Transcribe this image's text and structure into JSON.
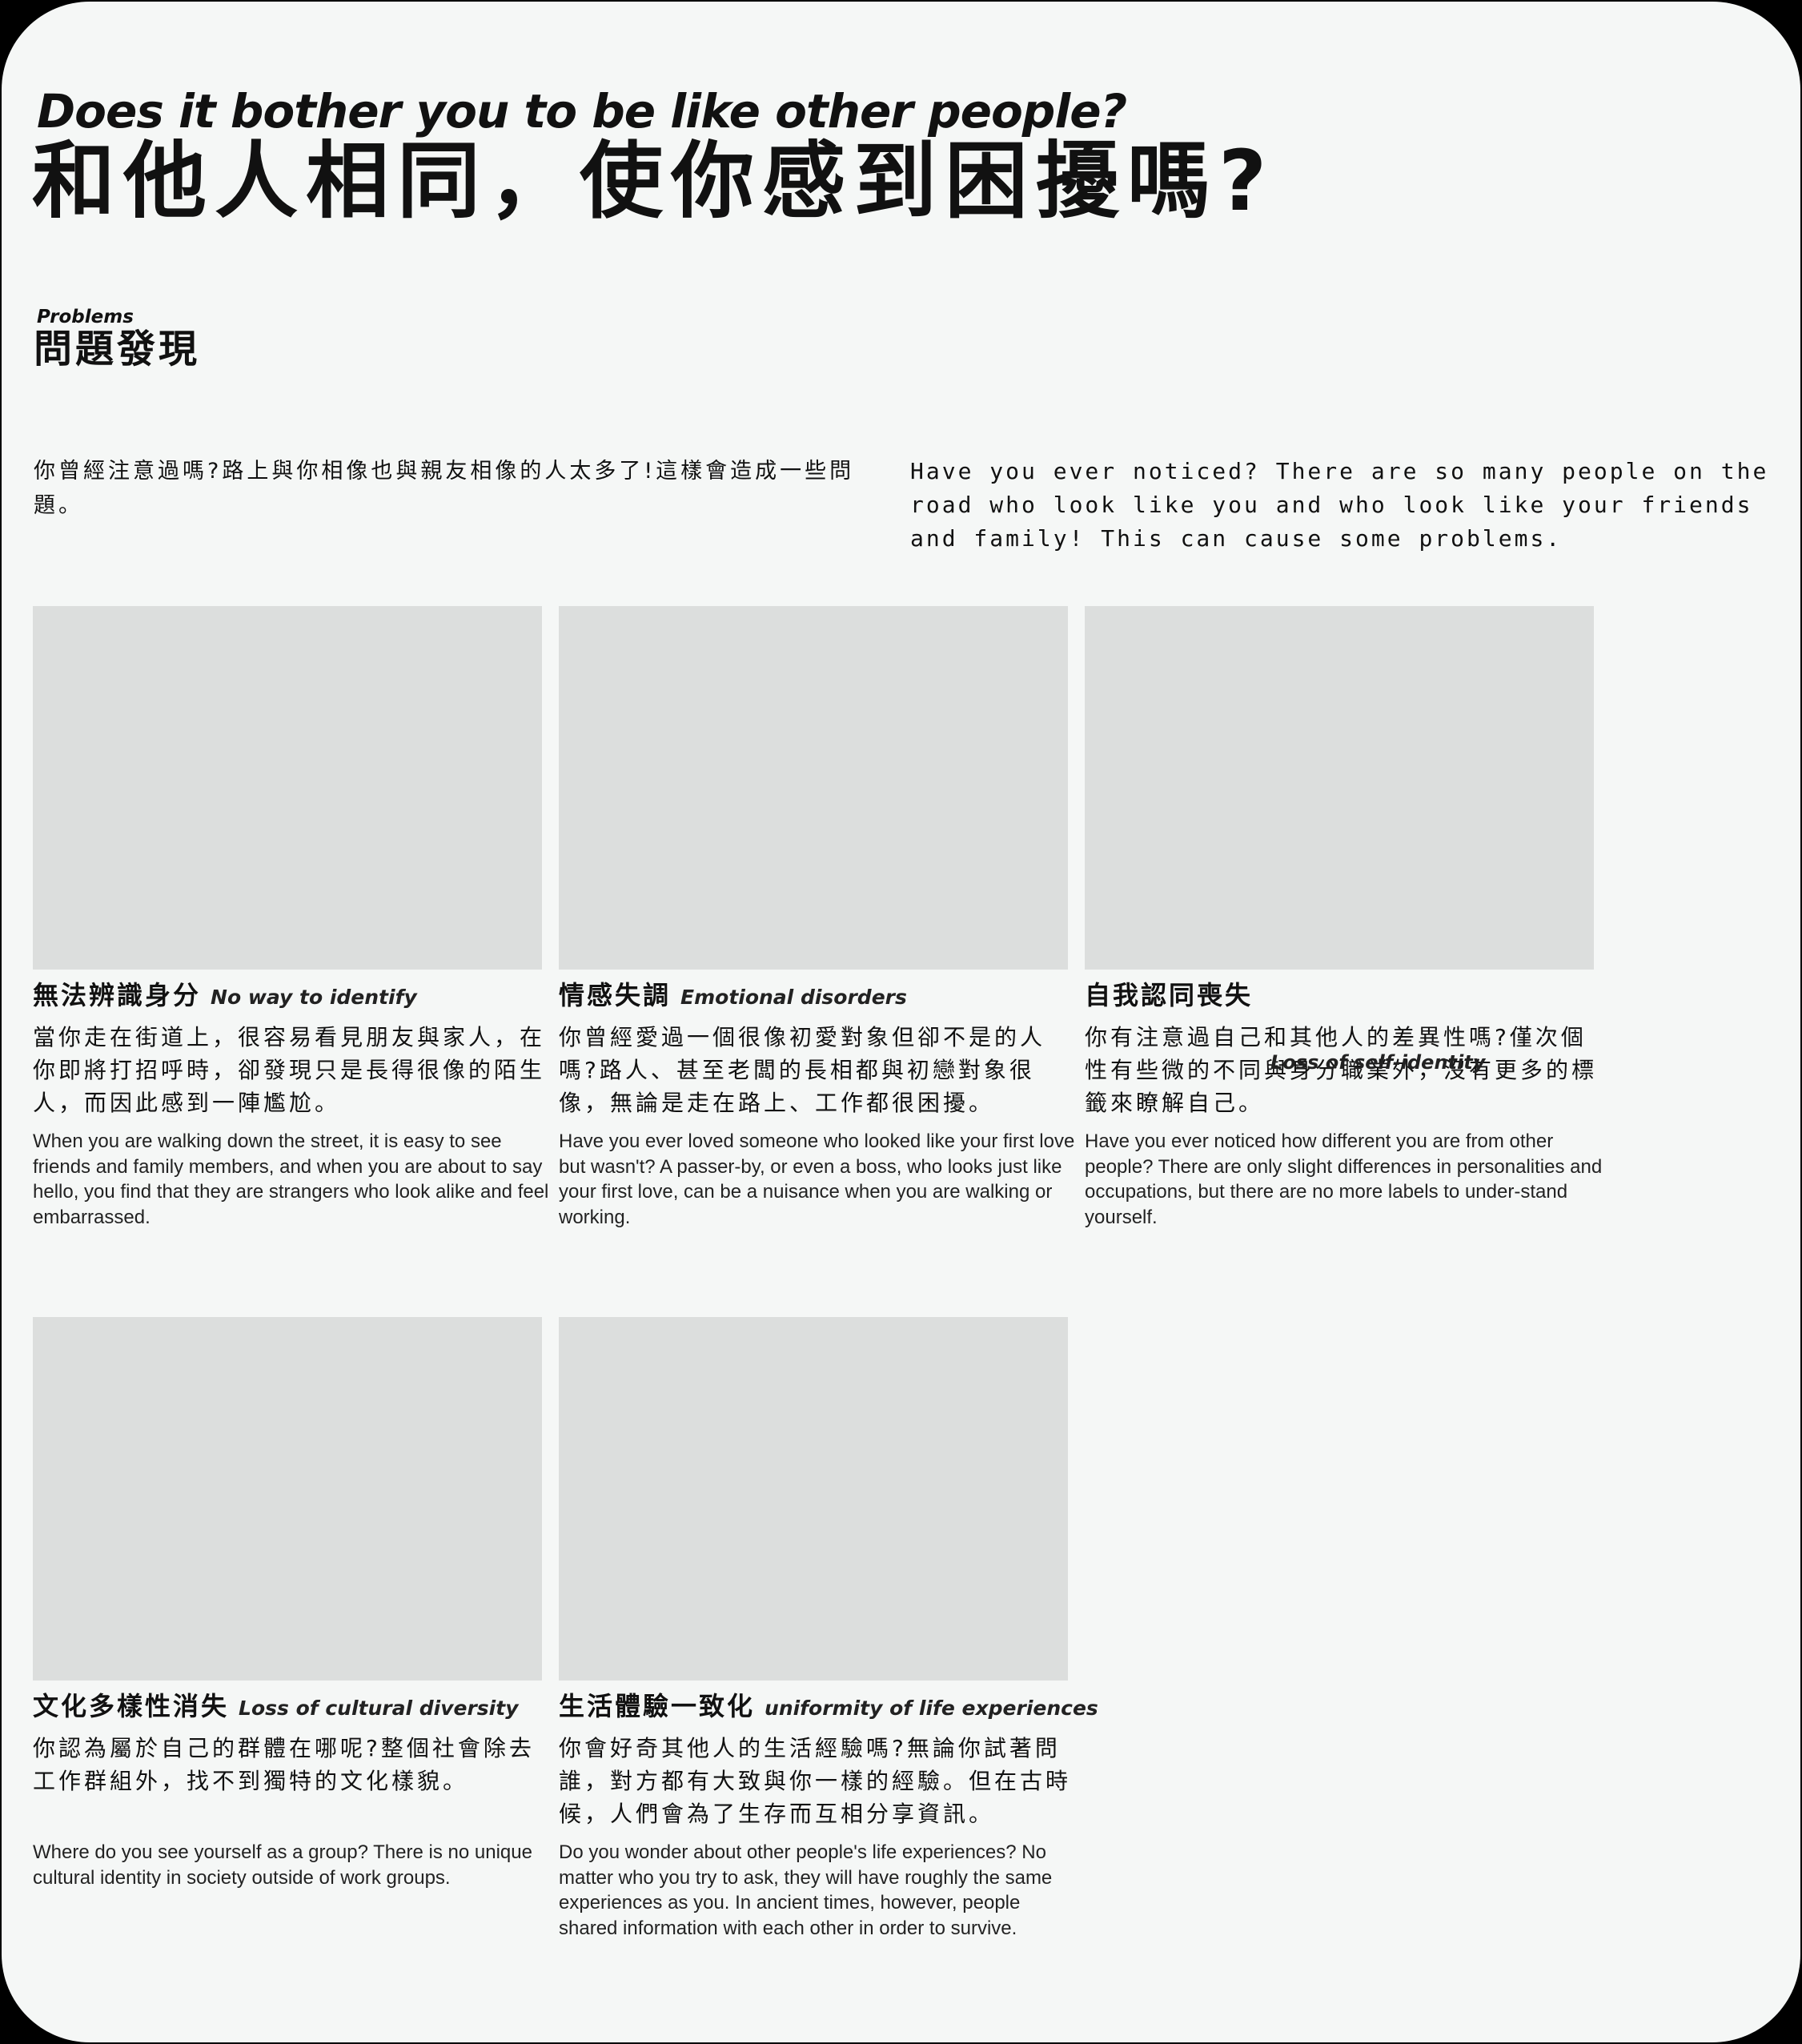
{
  "hero": {
    "title_en": "Does it bother you to be like other people?",
    "title_zh": "和他人相同，使你感到困擾嗎?"
  },
  "section": {
    "label_en": "Problems",
    "label_zh": "問題發現"
  },
  "intro": {
    "zh": "你曾經注意過嗎?路上與你相像也與親友相像的人太多了!這樣會造成一些問題。",
    "en": "Have you ever noticed? There are so many people on the road who look like you and who look like your friends and family! This can cause some problems."
  },
  "cards": [
    {
      "title_zh": "無法辨識身分",
      "title_en": "No way to identify",
      "body_zh": "當你走在街道上，很容易看見朋友與家人，在你即將打招呼時，卻發現只是長得很像的陌生人，而因此感到一陣尷尬。",
      "body_en": "When you are walking down the street, it is easy to see friends and family members, and when you are about to say hello, you find that they are strangers who look alike and feel embarrassed."
    },
    {
      "title_zh": "情感失調",
      "title_en": "Emotional disorders",
      "body_zh": "你曾經愛過一個很像初愛對象但卻不是的人嗎?路人、甚至老闆的長相都與初戀對象很像，無論是走在路上、工作都很困擾。",
      "body_en": "Have you ever loved someone who looked like your first love but wasn't? A passer-by, or even a boss, who looks just like your first love, can be a nuisance when you are walking or working."
    },
    {
      "title_zh": "自我認同喪失",
      "title_en": "Loss of self-identity",
      "body_zh": "你有注意過自己和其他人的差異性嗎?僅次個性有些微的不同與身分職業外，沒有更多的標籤來瞭解自己。",
      "body_en": "Have you ever noticed how different you are from other people? There are only slight differences in personalities and occupations, but there are no more labels to under-stand yourself."
    },
    {
      "title_zh": "文化多樣性消失",
      "title_en": "Loss of cultural diversity",
      "body_zh": "你認為屬於自己的群體在哪呢?整個社會除去工作群組外，找不到獨特的文化樣貌。",
      "body_en": "Where do you see yourself as a group? There is no unique cultural identity in society outside of work groups."
    },
    {
      "title_zh": "生活體驗一致化",
      "title_en": "uniformity of life experiences",
      "body_zh": "你會好奇其他人的生活經驗嗎?無論你試著問誰，對方都有大致與你一樣的經驗。但在古時候，人們會為了生存而互相分享資訊。",
      "body_en": "Do you wonder about other people's life experiences? No matter who you try to ask, they will have roughly the same experiences as you. In ancient times, however, people shared information with each other in order to survive."
    }
  ]
}
